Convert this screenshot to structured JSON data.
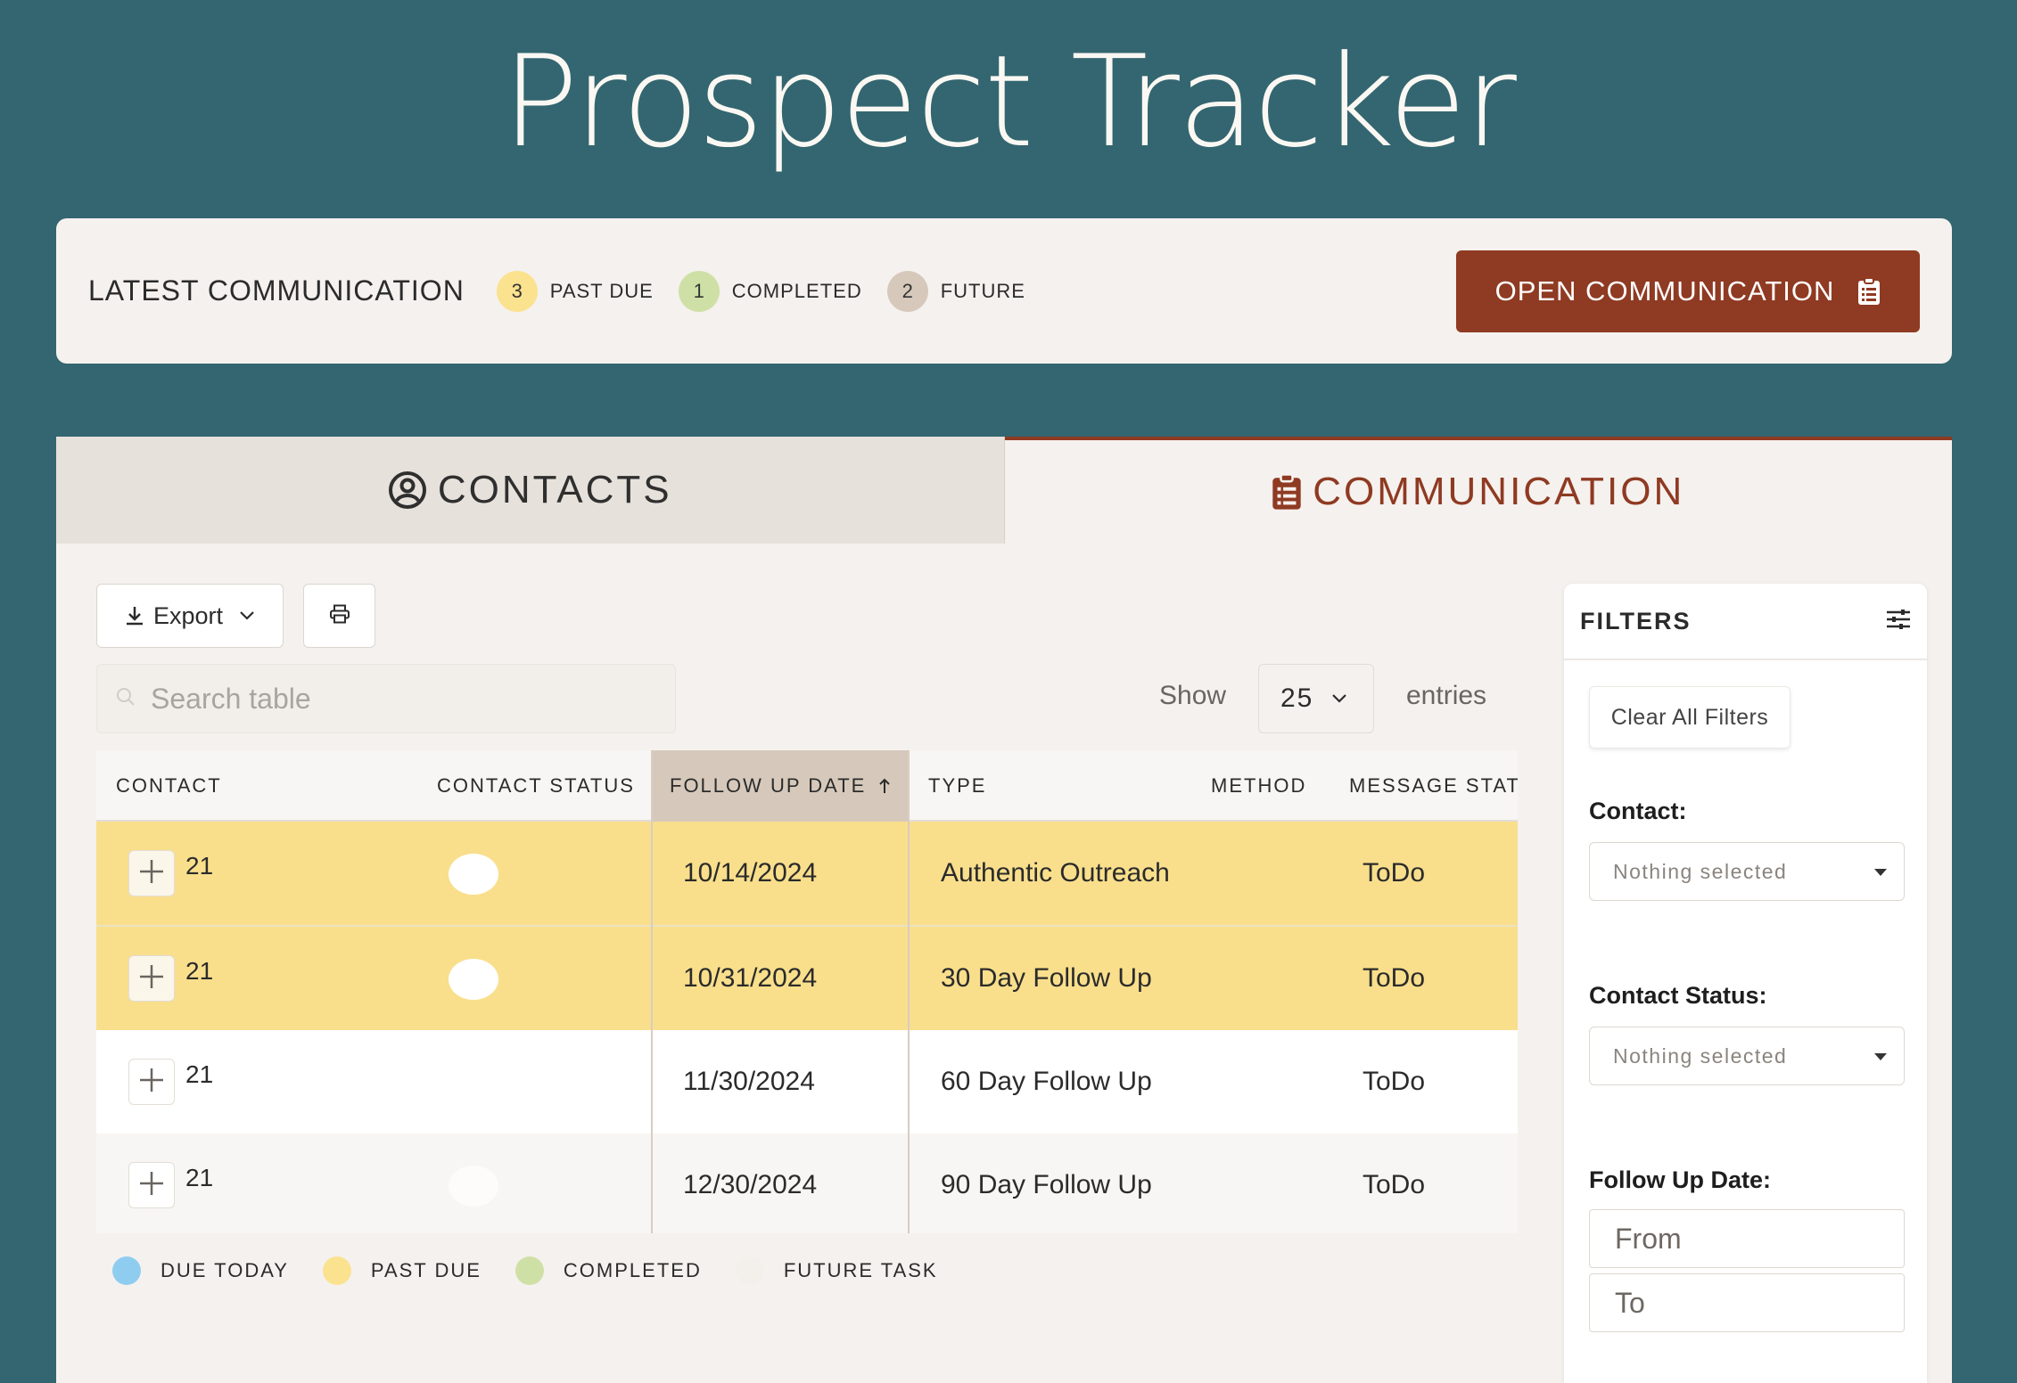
{
  "app": {
    "title": "Prospect Tracker"
  },
  "latest": {
    "label": "LATEST COMMUNICATION",
    "chips": [
      {
        "count": "3",
        "label": "PAST DUE",
        "color": "#fbe28f"
      },
      {
        "count": "1",
        "label": "COMPLETED",
        "color": "#cfe0a6"
      },
      {
        "count": "2",
        "label": "FUTURE",
        "color": "#d6c9bb"
      }
    ],
    "open_button": "OPEN COMMUNICATION"
  },
  "tabs": {
    "contacts": "CONTACTS",
    "communication": "COMMUNICATION",
    "active": "communication"
  },
  "toolbar": {
    "export_label": "Export",
    "print_icon": "printer-icon"
  },
  "search": {
    "placeholder": "Search table",
    "value": ""
  },
  "entries": {
    "show_label": "Show",
    "value": "25",
    "suffix": "entries"
  },
  "table": {
    "columns": [
      "CONTACT",
      "CONTACT STATUS",
      "FOLLOW UP DATE",
      "TYPE",
      "METHOD",
      "MESSAGE STATU"
    ],
    "sorted_column": "FOLLOW UP DATE",
    "sort_direction": "ascending",
    "rows": [
      {
        "contact": "21",
        "date": "10/14/2024",
        "type": "Authentic Outreach",
        "method": "",
        "message_status": "ToDo",
        "state": "past_due"
      },
      {
        "contact": "21",
        "date": "10/31/2024",
        "type": "30 Day Follow Up",
        "method": "",
        "message_status": "ToDo",
        "state": "past_due"
      },
      {
        "contact": "21",
        "date": "11/30/2024",
        "type": "60 Day Follow Up",
        "method": "",
        "message_status": "ToDo",
        "state": "future"
      },
      {
        "contact": "21",
        "date": "12/30/2024",
        "type": "90 Day Follow Up",
        "method": "",
        "message_status": "ToDo",
        "state": "future"
      }
    ]
  },
  "legend": [
    {
      "label": "DUE TODAY",
      "color": "#8fcdf0"
    },
    {
      "label": "PAST DUE",
      "color": "#fbe28f"
    },
    {
      "label": "COMPLETED",
      "color": "#cfe0a6"
    },
    {
      "label": "FUTURE TASK",
      "color": "#f3efeb"
    }
  ],
  "filters": {
    "title": "FILTERS",
    "clear_label": "Clear All Filters",
    "contact_label": "Contact:",
    "contact_value": "Nothing selected",
    "status_label": "Contact Status:",
    "status_value": "Nothing selected",
    "date_label": "Follow Up Date:",
    "from_placeholder": "From",
    "to_placeholder": "To"
  },
  "colors": {
    "background": "#336670",
    "accent": "#8f3a22",
    "past_due_row": "#f9df8c",
    "sorted_header": "#d6c9bb"
  }
}
